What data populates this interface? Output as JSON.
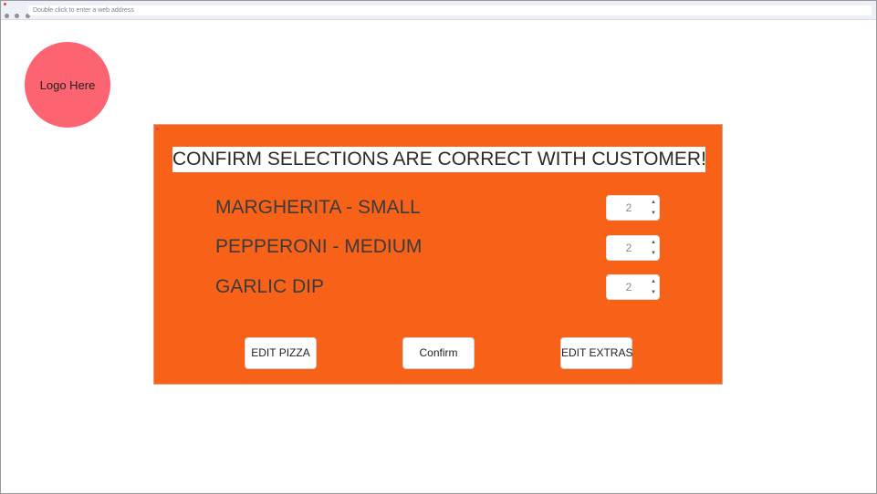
{
  "browser": {
    "address_placeholder": "Double click to enter a web address"
  },
  "logo": {
    "label": "Logo Here"
  },
  "panel": {
    "heading": "CONFIRM SELECTIONS ARE CORRECT WITH CUSTOMER!",
    "items": [
      {
        "label": "MARGHERITA - SMALL",
        "quantity": "2"
      },
      {
        "label": "PEPPERONI - MEDIUM",
        "quantity": "2"
      },
      {
        "label": "GARLIC DIP",
        "quantity": "2"
      }
    ],
    "buttons": {
      "edit_pizza": "EDIT PIZZA",
      "confirm": "Confirm",
      "edit_extras": "EDIT EXTRAS"
    }
  },
  "colors": {
    "panel_background": "#f76218",
    "logo_background": "#fc6472"
  }
}
